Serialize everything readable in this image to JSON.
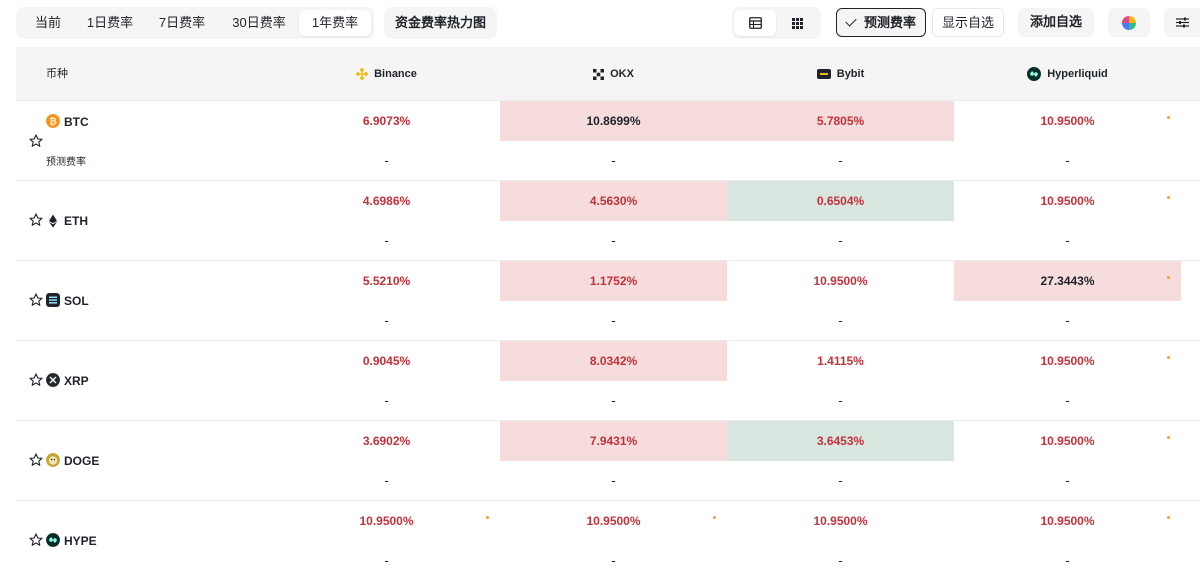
{
  "toolbar": {
    "periods": [
      "当前",
      "1日费率",
      "7日费率",
      "30日费率",
      "1年费率"
    ],
    "active_period": "1年费率",
    "heatmap_label": "资金费率热力图",
    "view_table_icon": "table-icon",
    "view_grid_icon": "grid-icon",
    "predict_label": "预测费率",
    "show_favorites_label": "显示自选",
    "add_favorites_label": "添加自选",
    "color_icon": "color-wheel-icon",
    "settings_icon": "sliders-icon"
  },
  "table": {
    "coin_header": "币种",
    "exchanges": [
      {
        "name": "Binance",
        "icon": "binance-logo-icon"
      },
      {
        "name": "OKX",
        "icon": "okx-logo-icon"
      },
      {
        "name": "Bybit",
        "icon": "bybit-logo-icon"
      },
      {
        "name": "Hyperliquid",
        "icon": "hyperliquid-logo-icon"
      }
    ],
    "predicted_label": "预测费率",
    "rows": [
      {
        "symbol": "BTC",
        "icon": "btc-coin-icon",
        "rates": [
          "6.9073%",
          "10.8699%",
          "5.7805%",
          "10.9500%"
        ],
        "predicted": [
          "-",
          "-",
          "-",
          "-"
        ]
      },
      {
        "symbol": "ETH",
        "icon": "eth-coin-icon",
        "rates": [
          "4.6986%",
          "4.5630%",
          "0.6504%",
          "10.9500%"
        ],
        "predicted": [
          "-",
          "-",
          "-",
          "-"
        ]
      },
      {
        "symbol": "SOL",
        "icon": "sol-coin-icon",
        "rates": [
          "5.5210%",
          "1.1752%",
          "10.9500%",
          "27.3443%"
        ],
        "predicted": [
          "-",
          "-",
          "-",
          "-"
        ]
      },
      {
        "symbol": "XRP",
        "icon": "xrp-coin-icon",
        "rates": [
          "0.9045%",
          "8.0342%",
          "1.4115%",
          "10.9500%"
        ],
        "predicted": [
          "-",
          "-",
          "-",
          "-"
        ]
      },
      {
        "symbol": "DOGE",
        "icon": "doge-coin-icon",
        "rates": [
          "3.6902%",
          "7.9431%",
          "3.6453%",
          "10.9500%"
        ],
        "predicted": [
          "-",
          "-",
          "-",
          "-"
        ]
      },
      {
        "symbol": "HYPE",
        "icon": "hype-coin-icon",
        "rates": [
          "10.9500%",
          "10.9500%",
          "10.9500%",
          "10.9500%"
        ],
        "predicted": [
          "-",
          "-",
          "-",
          "-"
        ]
      }
    ]
  },
  "colors": {
    "positive_rate": "#c2323a",
    "highlight_red": "#f7dcdd",
    "highlight_green": "#d9e6df",
    "cap_dot": "#f0a32c"
  }
}
